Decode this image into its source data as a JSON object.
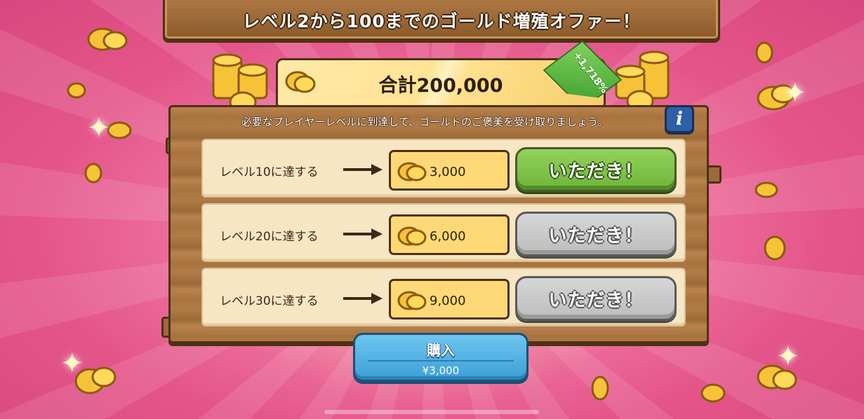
{
  "offer": {
    "title": "レベル2から100までのゴールド増殖オファー！",
    "total_label": "合計200,000",
    "bonus_badge": "+1,718%",
    "description": "必要なプレイヤーレベルに到達して、ゴールドのご褒美を受け取りましょう。",
    "info_icon_glyph": "i"
  },
  "rewards": [
    {
      "label": "レベル10に達する",
      "amount": "3,000",
      "button": "いただき！",
      "state": "available"
    },
    {
      "label": "レベル20に達する",
      "amount": "6,000",
      "button": "いただき！",
      "state": "locked"
    },
    {
      "label": "レベル30に達する",
      "amount": "9,000",
      "button": "いただき！",
      "state": "locked"
    }
  ],
  "purchase": {
    "label": "購入",
    "price": "¥3,000"
  },
  "colors": {
    "background": "#e4558a",
    "wood": "#a8733f",
    "claim_available": "#7cc246",
    "claim_locked": "#c9c9c9",
    "buy_button": "#4aa9dd",
    "gold_box": "#ffd977"
  },
  "icons": [
    "gold-coin-icon",
    "arrow-right-icon",
    "info-icon",
    "sparkle-icon"
  ]
}
